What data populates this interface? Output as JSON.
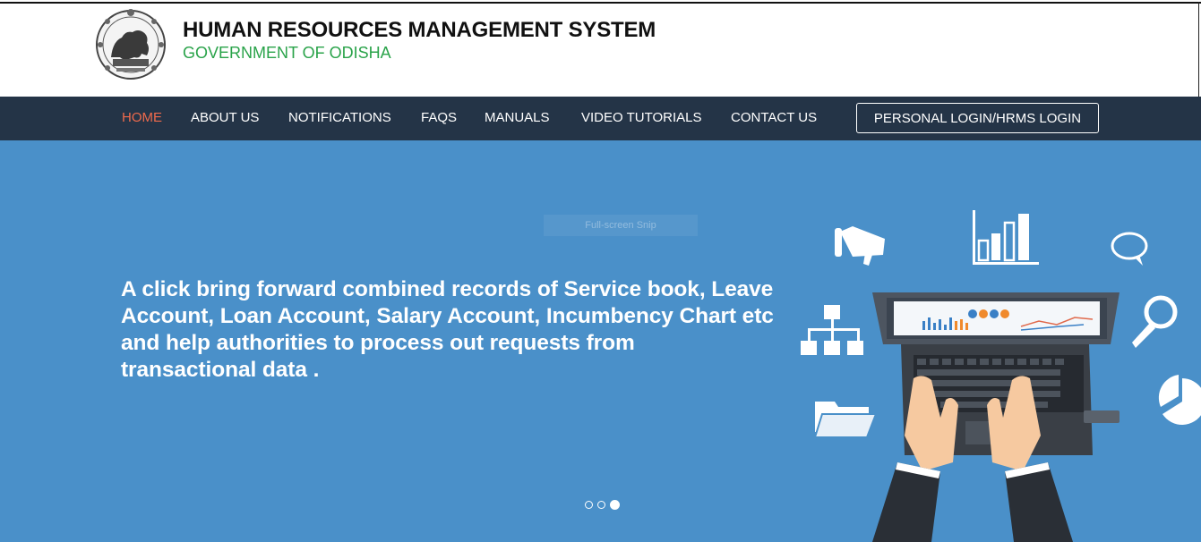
{
  "header": {
    "title": "HUMAN RESOURCES MANAGEMENT SYSTEM",
    "subtitle": "GOVERNMENT OF ODISHA",
    "logo": "odisha-state-emblem"
  },
  "nav": {
    "items": [
      {
        "label": "HOME",
        "active": true
      },
      {
        "label": "ABOUT US"
      },
      {
        "label": "NOTIFICATIONS"
      },
      {
        "label": "FAQS"
      },
      {
        "label": "MANUALS"
      },
      {
        "label": "VIDEO TUTORIALS"
      },
      {
        "label": "CONTACT US"
      }
    ],
    "login_label": "PERSONAL LOGIN/HRMS LOGIN"
  },
  "hero": {
    "overlay_text": "Full-screen Snip",
    "text": "A click bring forward combined records of Service book, Leave Account, Loan Account, Salary Account, Incumbency Chart etc and help authorities to process out requests from transactional data .",
    "slides_total": 3,
    "active_slide": 3
  },
  "colors": {
    "navbar": "#243447",
    "hero": "#4a90c9",
    "active_nav": "#ef6a4c",
    "subtitle": "#2aa34a"
  },
  "icons": [
    "megaphone-icon",
    "bar-chart-icon",
    "chat-bubble-icon",
    "org-chart-icon",
    "magnifier-icon",
    "folder-icon",
    "pie-chart-icon",
    "laptop-icon"
  ]
}
